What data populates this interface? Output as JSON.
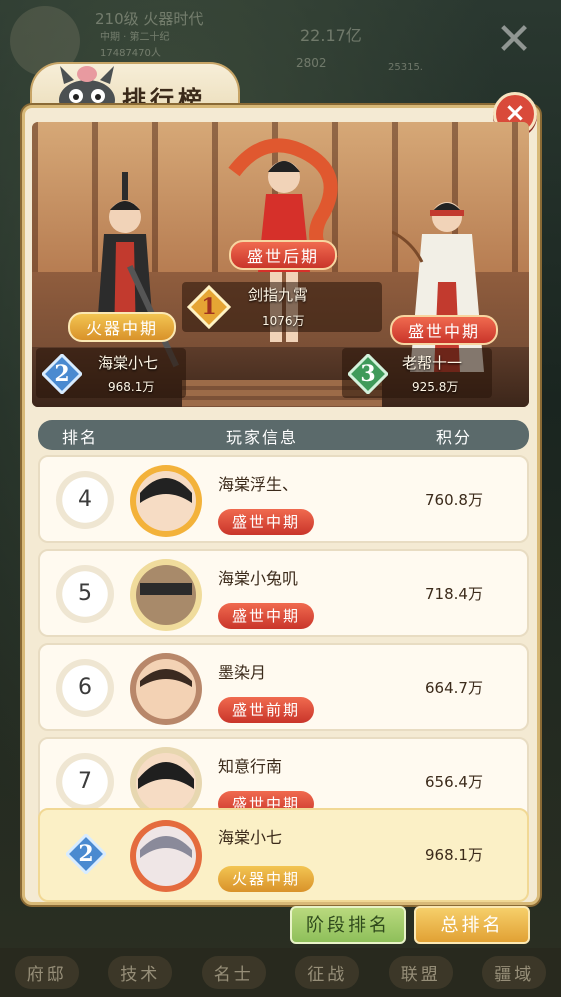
{
  "background": {
    "level_title": "210级 火器时代",
    "period": "中期 · 第二十纪",
    "population": "17487470人",
    "gold": "22.17亿",
    "power": "2802",
    "power2": "25315."
  },
  "panel": {
    "title": "排行榜",
    "close_symbol": "×"
  },
  "podium": {
    "first": {
      "rank": "1",
      "name": "剑指九霄",
      "score": "1076万",
      "stage": "盛世后期"
    },
    "second": {
      "rank": "2",
      "name": "海棠小七",
      "score": "968.1万",
      "stage": "火器中期"
    },
    "third": {
      "rank": "3",
      "name": "老帮十一",
      "score": "925.8万",
      "stage": "盛世中期"
    }
  },
  "columns": {
    "rank": "排名",
    "player": "玩家信息",
    "score": "积分"
  },
  "rows": [
    {
      "rank": "4",
      "name": "海棠浮生、",
      "stage": "盛世中期",
      "score": "760.8万"
    },
    {
      "rank": "5",
      "name": "海棠小兔叽",
      "stage": "盛世中期",
      "score": "718.4万"
    },
    {
      "rank": "6",
      "name": "墨染月",
      "stage": "盛世前期",
      "score": "664.7万"
    },
    {
      "rank": "7",
      "name": "知意行南",
      "stage": "盛世中期",
      "score": "656.4万"
    }
  ],
  "self_row": {
    "rank": "2",
    "name": "海棠小七",
    "stage": "火器中期",
    "score": "968.1万"
  },
  "buttons": {
    "stage_rank": "阶段排名",
    "total_rank": "总排名"
  },
  "bottom_nav": [
    "府邸",
    "技术",
    "名士",
    "征战",
    "联盟",
    "疆域"
  ],
  "colors": {
    "panel_bg": "#f4ead3",
    "header_bar": "#5b6a6b",
    "tag_red": "#d9432f",
    "tag_gold": "#e3a53a",
    "self_row_bg": "#fbf0c6",
    "button_green": "#a3cc6b",
    "button_gold": "#eeb84e"
  }
}
